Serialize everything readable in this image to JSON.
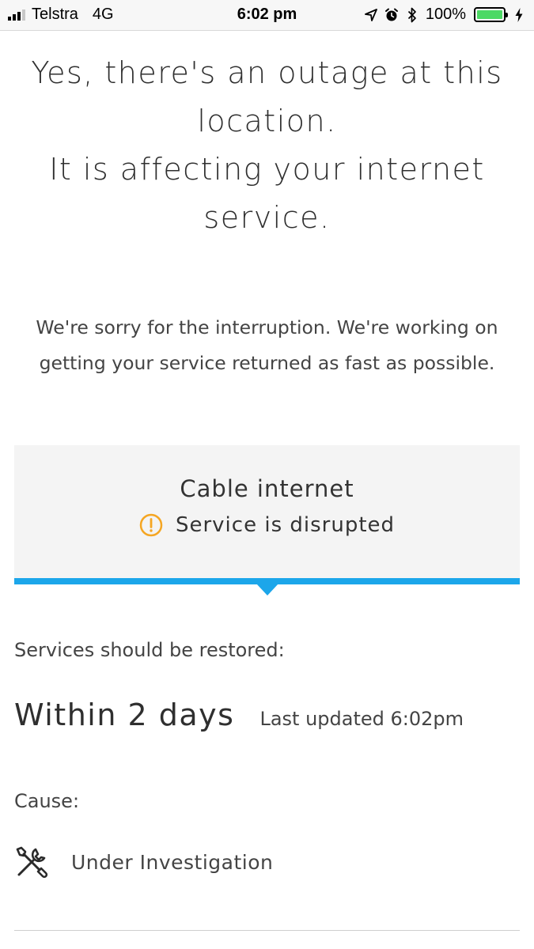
{
  "status_bar": {
    "carrier": "Telstra",
    "network": "4G",
    "time": "6:02 pm",
    "battery": "100%",
    "battery_level": 1.0,
    "battery_color": "#4cd964"
  },
  "headline": {
    "line1": "Yes, there's an outage at this",
    "line2": "location.",
    "line3": "It is affecting your internet",
    "line4": "service."
  },
  "apology": {
    "line1": "We're sorry for the interruption. We're working on",
    "line2": "getting your service returned as fast as possible."
  },
  "service_card": {
    "name": "Cable internet",
    "status": "Service is disrupted",
    "status_icon": "warning-icon",
    "status_color": "#f5a623",
    "accent_color": "#1ca6ea"
  },
  "restoration": {
    "label": "Services should be restored:",
    "value": "Within 2 days",
    "last_updated": "Last updated 6:02pm"
  },
  "cause": {
    "label": "Cause:",
    "icon": "tools-icon",
    "value": "Under Investigation"
  }
}
